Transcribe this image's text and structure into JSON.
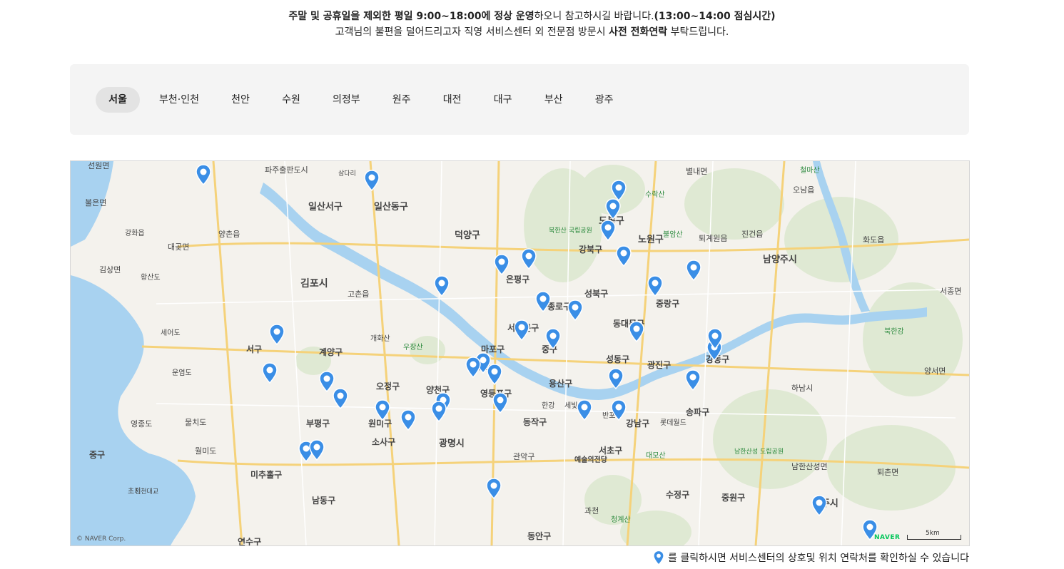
{
  "notice": {
    "line1_bold1": "주말 및 공휴일을 제외한 평일 9:00~18:00에 정상 운영",
    "line1_normal": "하오니 참고하시길 바랍니다.",
    "line1_bold2": "(13:00~14:00 점심시간)",
    "line2_normal1": "고객님의 불편을 덜어드리고자 직영 서비스센터 외 전문점 방문시 ",
    "line2_bold": "사전 전화연락",
    "line2_normal2": " 부탁드립니다."
  },
  "regions": [
    {
      "label": "서울",
      "active": true
    },
    {
      "label": "부천·인천",
      "active": false
    },
    {
      "label": "천안",
      "active": false
    },
    {
      "label": "수원",
      "active": false
    },
    {
      "label": "의정부",
      "active": false
    },
    {
      "label": "원주",
      "active": false
    },
    {
      "label": "대전",
      "active": false
    },
    {
      "label": "대구",
      "active": false
    },
    {
      "label": "부산",
      "active": false
    },
    {
      "label": "광주",
      "active": false
    }
  ],
  "map": {
    "copyright": "© NAVER Corp.",
    "logo": "NAVER",
    "scale_label": "5km",
    "marker_color": "#3a8ee6",
    "water_color": "#a8d2f0",
    "place_labels": [
      "선원면",
      "파주출판도시",
      "삼다리",
      "별내면",
      "철마산",
      "불은면",
      "일산서구",
      "일산동구",
      "도봉구",
      "수락산",
      "오남읍",
      "덕양구",
      "북한산 국립공원",
      "노원구",
      "불암산",
      "퇴계원읍",
      "진건읍",
      "화도읍",
      "강화읍",
      "양촌읍",
      "대곶면",
      "강북구",
      "남양주시",
      "김상면",
      "황산도",
      "김포시",
      "고촌읍",
      "은평구",
      "성북구",
      "중랑구",
      "서종면",
      "서대문구",
      "종로구",
      "동대문구",
      "세어도",
      "북한강",
      "서구",
      "계양구",
      "마포구",
      "중구",
      "성동구",
      "광진구",
      "강동구",
      "운염도",
      "오정구",
      "양천구",
      "영등포구",
      "용산구",
      "하남시",
      "양서면",
      "부평구",
      "원미구",
      "동작구",
      "서초구",
      "강남구",
      "송파구",
      "롯데월드",
      "소사구",
      "광명시",
      "남한산성 도립공원",
      "남한산성면",
      "퇴촌면",
      "중구",
      "미추홀구",
      "관악구",
      "예술의전당",
      "대모산",
      "수정구",
      "중원구",
      "광주시",
      "남동구",
      "과천",
      "청계산",
      "동안구",
      "연수구",
      "영종도",
      "물치도",
      "월미도",
      "초지",
      "인천대교",
      "우장산",
      "성산",
      "한강",
      "세빛섬",
      "반포",
      "개화산",
      "영종도"
    ],
    "markers": [
      "marker-1",
      "marker-2",
      "marker-3",
      "marker-4",
      "marker-5",
      "marker-6",
      "marker-7",
      "marker-8",
      "marker-9",
      "marker-10",
      "marker-11",
      "marker-12",
      "marker-13",
      "marker-14",
      "marker-15",
      "marker-16",
      "marker-17",
      "marker-18",
      "marker-19",
      "marker-20",
      "marker-21",
      "marker-22",
      "marker-23",
      "marker-24",
      "marker-25",
      "marker-26",
      "marker-27",
      "marker-28",
      "marker-29",
      "marker-30",
      "marker-31",
      "marker-32",
      "marker-33",
      "marker-34",
      "marker-35",
      "marker-36",
      "marker-37",
      "marker-38",
      "marker-39"
    ]
  },
  "footer": {
    "hint": "를 클릭하시면 서비스센터의 상호및 위치 연락처를 확인하실 수 있습니다",
    "icon": "map-pin-icon"
  }
}
